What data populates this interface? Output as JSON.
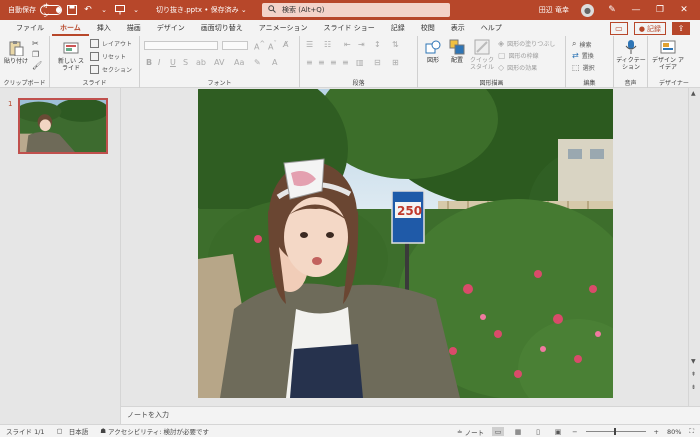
{
  "titlebar": {
    "autosave_label": "自動保存",
    "autosave_state": "オン",
    "doc_title": "切り抜き.pptx • 保存済み",
    "doc_title_caret": "⌄",
    "search_placeholder": "検索 (Alt+Q)",
    "user_name": "田辺 竜幸",
    "accent_color": "#b7472a"
  },
  "tabs": [
    "ファイル",
    "ホーム",
    "挿入",
    "描画",
    "デザイン",
    "画面切り替え",
    "アニメーション",
    "スライド ショー",
    "記録",
    "校閲",
    "表示",
    "ヘルプ"
  ],
  "active_tab": "ホーム",
  "tab_right": {
    "record_label": "記録"
  },
  "ribbon": {
    "clipboard": {
      "paste_label": "貼り付け",
      "group_label": "クリップボード"
    },
    "slides": {
      "new_slide_label": "新しい スライド",
      "layout_label": "レイアウト",
      "reset_label": "リセット",
      "section_label": "セクション",
      "group_label": "スライド"
    },
    "font": {
      "group_label": "フォント"
    },
    "paragraph": {
      "group_label": "段落"
    },
    "drawing": {
      "shapes_label": "図形",
      "arrange_label": "配置",
      "quick_styles_label": "クイック スタイル",
      "fill_label": "図形の塗りつぶし",
      "outline_label": "図形の枠線",
      "effects_label": "図形の効果",
      "group_label": "図形描画"
    },
    "editing": {
      "find_label": "検索",
      "replace_label": "置換",
      "select_label": "選択",
      "group_label": "編集"
    },
    "voice": {
      "dictate_label": "ディクテーション",
      "group_label": "音声"
    },
    "designer": {
      "design_ideas_label": "デザイン アイデア",
      "group_label": "デザイナー"
    }
  },
  "thumbnails": [
    {
      "number": "1"
    }
  ],
  "slide_image": {
    "sign_text": "250"
  },
  "notes_placeholder": "ノートを入力",
  "status": {
    "slide_info": "スライド 1/1",
    "language": "日本語",
    "accessibility": "アクセシビリティ: 検討が必要です",
    "notes_label": "ノート",
    "zoom": "80%"
  }
}
